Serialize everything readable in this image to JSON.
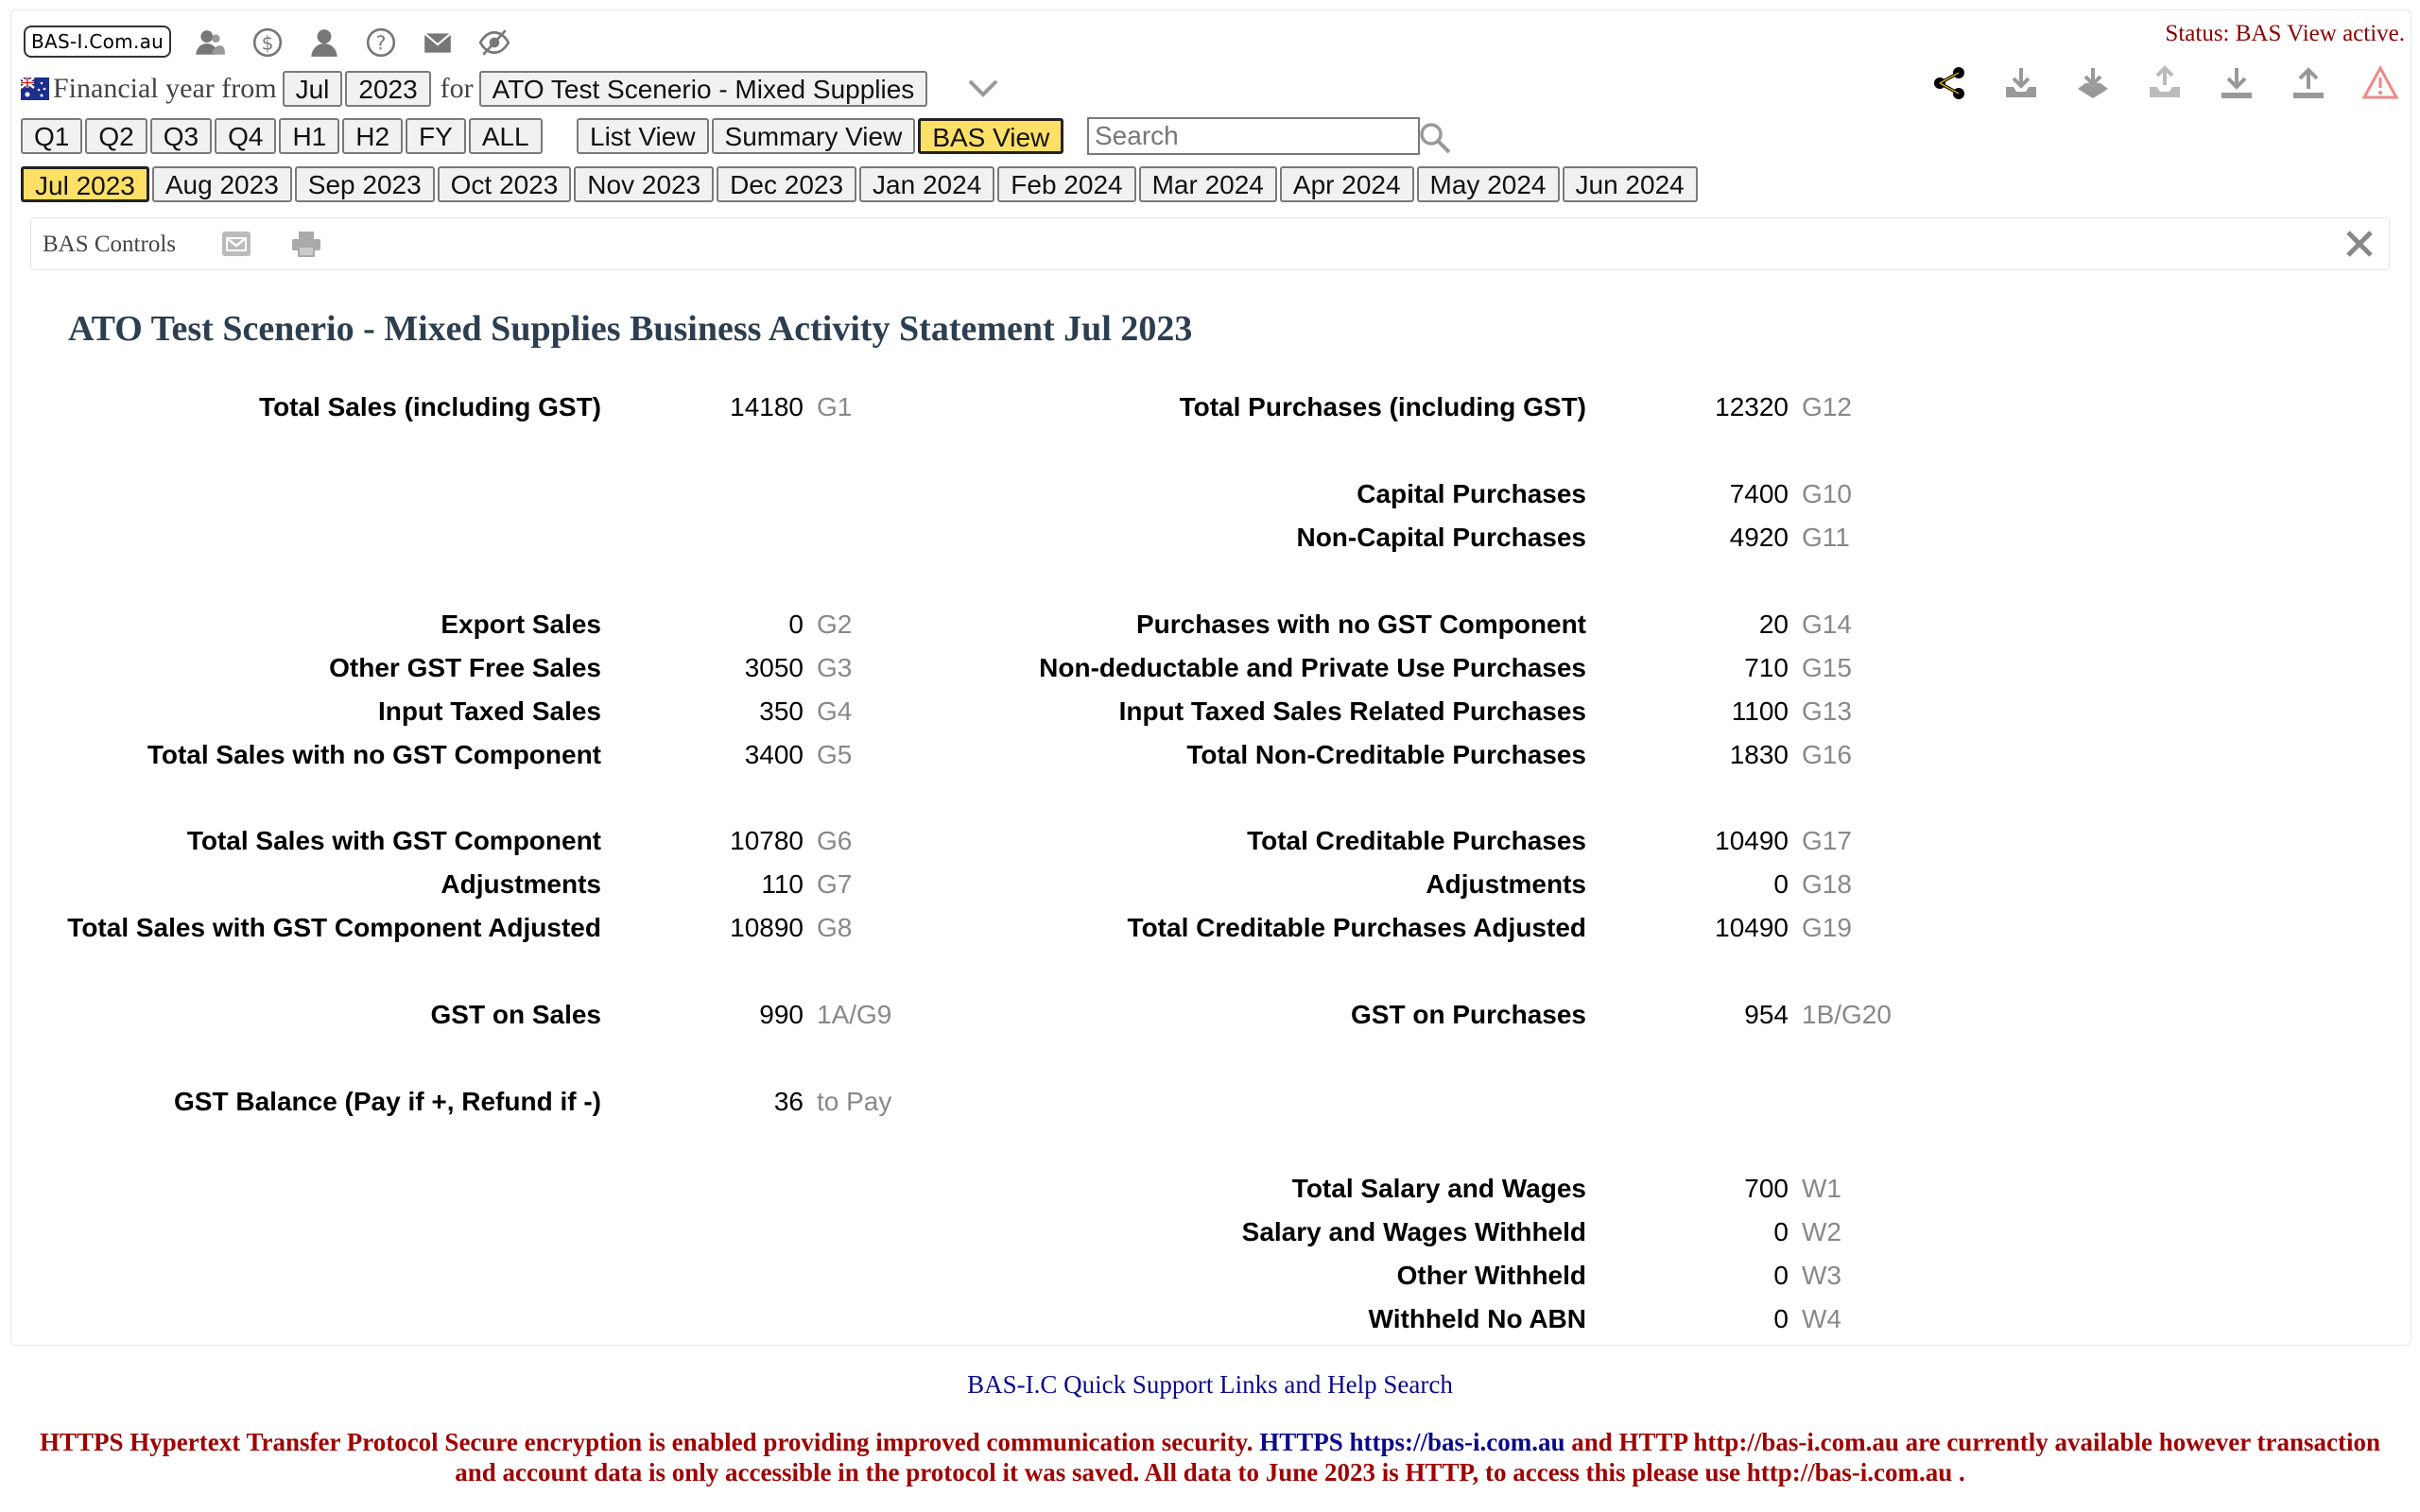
{
  "brand": {
    "logo_text": "BAS-I.Com.au"
  },
  "top_icons": [
    "users-icon",
    "dollar-icon",
    "user-icon",
    "help-icon",
    "mail-icon",
    "hide-icon"
  ],
  "status": "Status: BAS View active.",
  "period_selector": {
    "label": "Financial year from",
    "month": "Jul",
    "year": "2023",
    "for_label": "for",
    "entity": "ATO Test Scenerio - Mixed Supplies"
  },
  "right_actions": [
    "share-icon",
    "download-tray-icon",
    "import-icon",
    "export-icon",
    "download-icon",
    "upload-icon",
    "warning-icon"
  ],
  "period_buttons": [
    "Q1",
    "Q2",
    "Q3",
    "Q4",
    "H1",
    "H2",
    "FY",
    "ALL"
  ],
  "view_buttons": {
    "list": "List View",
    "summary": "Summary View",
    "bas": "BAS View"
  },
  "search": {
    "placeholder": "Search",
    "value": ""
  },
  "months": [
    "Jul 2023",
    "Aug 2023",
    "Sep 2023",
    "Oct 2023",
    "Nov 2023",
    "Dec 2023",
    "Jan 2024",
    "Feb 2024",
    "Mar 2024",
    "Apr 2024",
    "May 2024",
    "Jun 2024"
  ],
  "active_month": "Jul 2023",
  "controls": {
    "label": "BAS Controls"
  },
  "statement": {
    "title": "ATO Test Scenerio - Mixed Supplies Business Activity Statement Jul 2023",
    "sales": [
      {
        "label": "Total Sales (including GST)",
        "value": "14180",
        "code": "G1"
      },
      {
        "label": "Export Sales",
        "value": "0",
        "code": "G2"
      },
      {
        "label": "Other GST Free Sales",
        "value": "3050",
        "code": "G3"
      },
      {
        "label": "Input Taxed Sales",
        "value": "350",
        "code": "G4"
      },
      {
        "label": "Total Sales with no GST Component",
        "value": "3400",
        "code": "G5"
      },
      {
        "label": "Total Sales with GST Component",
        "value": "10780",
        "code": "G6"
      },
      {
        "label": "Adjustments",
        "value": "110",
        "code": "G7"
      },
      {
        "label": "Total Sales with GST Component Adjusted",
        "value": "10890",
        "code": "G8"
      },
      {
        "label": "GST on Sales",
        "value": "990",
        "code": "1A/G9"
      },
      {
        "label": "GST Balance (Pay if +, Refund if -)",
        "value": "36",
        "code": "to Pay"
      }
    ],
    "purchases": [
      {
        "label": "Total Purchases (including GST)",
        "value": "12320",
        "code": "G12"
      },
      {
        "label": "Capital Purchases",
        "value": "7400",
        "code": "G10"
      },
      {
        "label": "Non-Capital Purchases",
        "value": "4920",
        "code": "G11"
      },
      {
        "label": "Purchases with no GST Component",
        "value": "20",
        "code": "G14"
      },
      {
        "label": "Non-deductable and Private Use Purchases",
        "value": "710",
        "code": "G15"
      },
      {
        "label": "Input Taxed Sales Related Purchases",
        "value": "1100",
        "code": "G13"
      },
      {
        "label": "Total Non-Creditable Purchases",
        "value": "1830",
        "code": "G16"
      },
      {
        "label": "Total Creditable Purchases",
        "value": "10490",
        "code": "G17"
      },
      {
        "label": "Adjustments",
        "value": "0",
        "code": "G18"
      },
      {
        "label": "Total Creditable Purchases Adjusted",
        "value": "10490",
        "code": "G19"
      },
      {
        "label": "GST on Purchases",
        "value": "954",
        "code": "1B/G20"
      },
      {
        "label": "Total Salary and Wages",
        "value": "700",
        "code": "W1"
      },
      {
        "label": "Salary and Wages Withheld",
        "value": "0",
        "code": "W2"
      },
      {
        "label": "Other Withheld",
        "value": "0",
        "code": "W3"
      },
      {
        "label": "Withheld No ABN",
        "value": "0",
        "code": "W4"
      }
    ]
  },
  "footer": {
    "help_link": "BAS-I.C Quick Support Links and Help Search",
    "notice_1": "HTTPS Hypertext Transfer Protocol Secure encryption is enabled providing improved communication security.",
    "notice_https": "HTTPS https://bas-i.com.au",
    "notice_2": "and HTTP http://bas-i.com.au are currently available however transaction and account data is only accessible in the protocol it was saved. All data to June 2023 is HTTP, to access this please use http://bas-i.com.au ."
  },
  "colors": {
    "active": "#ffe066",
    "status": "#8b0000",
    "title": "#2c3e50",
    "link": "#0a0a8c",
    "notice": "#a00000"
  }
}
